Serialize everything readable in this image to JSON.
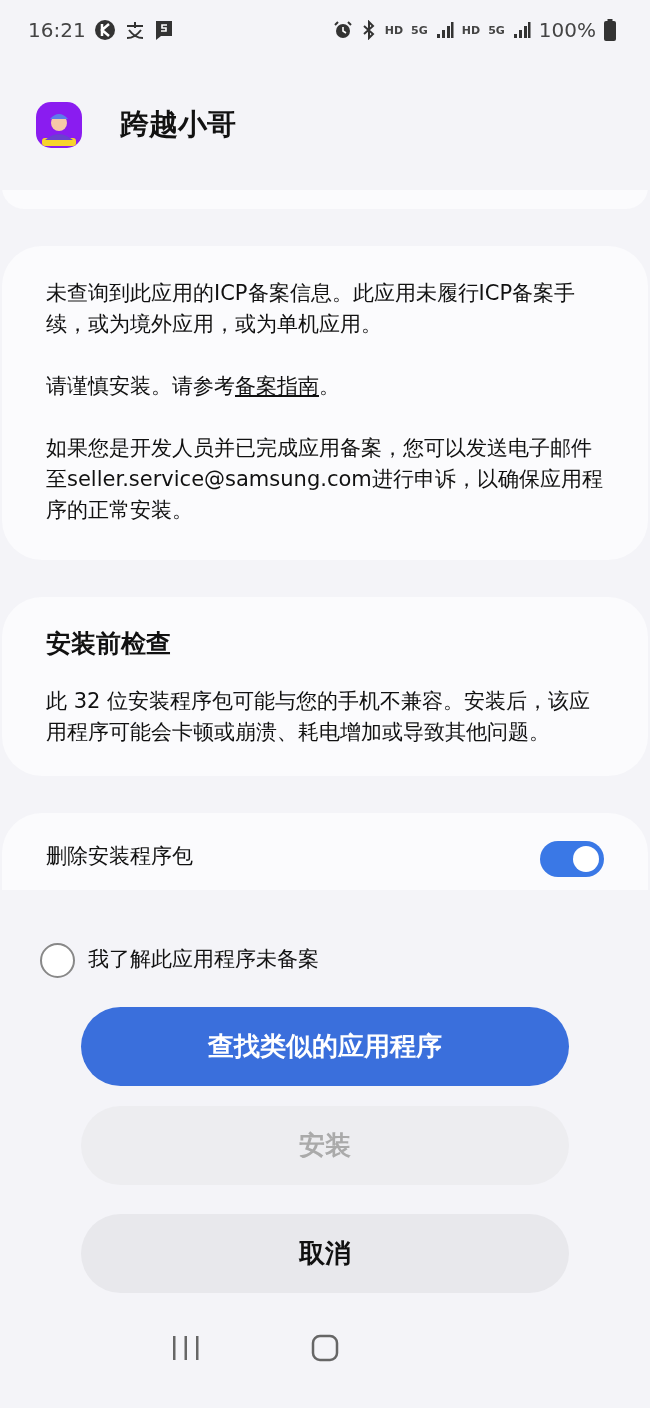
{
  "status_bar": {
    "time": "16:21",
    "indicators": [
      "HD",
      "5G",
      "HD",
      "5G"
    ],
    "battery": "100%"
  },
  "app": {
    "name": "跨越小哥"
  },
  "notice": {
    "paragraphs": [
      {
        "text": "未查询到此应用的ICP备案信息。此应用未履行ICP备案手续，或为境外应用，或为单机应用。"
      },
      {
        "text": "请谨慎安装。请参考",
        "link": "备案指南",
        "after": "。"
      },
      {
        "text": "如果您是开发人员并已完成应用备案，您可以发送电子邮件至seller.service@samsung.com进行申诉，以确保应用程序的正常安装。"
      }
    ]
  },
  "precheck": {
    "title": "安装前检查",
    "text": "此 32 位安装程序包可能与您的手机不兼容。安装后，该应用程序可能会卡顿或崩溃、耗电增加或导致其他问题。"
  },
  "option": {
    "label": "删除安装程序包",
    "on": true
  },
  "agree": {
    "label": "我了解此应用程序未备案",
    "checked": false
  },
  "buttons": [
    {
      "label": "查找类似的应用程序",
      "kind": "primary",
      "disabled": false
    },
    {
      "label": "安装",
      "kind": "secondary",
      "disabled": true
    },
    {
      "label": "取消",
      "kind": "secondary",
      "disabled": false
    }
  ]
}
